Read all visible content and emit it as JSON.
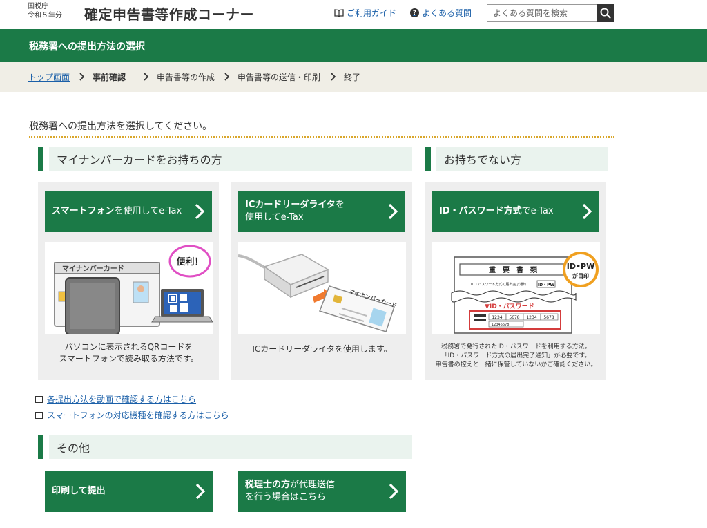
{
  "header": {
    "agency_line1": "国税庁",
    "agency_line2": "令和５年分",
    "app_title": "確定申告書等作成コーナー",
    "guide_link": "ご利用ガイド",
    "faq_link": "よくある質問",
    "search_placeholder": "よくある質問を検索"
  },
  "page": {
    "title": "税務署への提出方法の選択",
    "instruction": "税務署への提出方法を選択してください。"
  },
  "breadcrumb": {
    "items": [
      "トップ画面",
      "事前確認",
      "申告書等の作成",
      "申告書等の送信・印刷",
      "終了"
    ]
  },
  "sections": {
    "mynumber": "マイナンバーカードをお持ちの方",
    "nocard": "お持ちでない方",
    "other": "その他"
  },
  "cards": {
    "smartphone": {
      "label_bold": "スマートフォン",
      "label_rest": "を使用してe-Tax",
      "caption_line1": "パソコンに表示されるQRコードを",
      "caption_line2": "スマートフォンで読み取る方法です。",
      "illus_card_label": "マイナンバーカード",
      "illus_bubble": "便利！"
    },
    "icreader": {
      "label_bold": "ICカードリーダライタ",
      "label_rest1": "を",
      "label_rest2": "使用してe-Tax",
      "caption": "ICカードリーダライタを使用します。",
      "illus_card_label": "マイナンバーカード"
    },
    "idpw": {
      "label_bold": "ID・パスワード方式",
      "label_rest": "でe-Tax",
      "caption_line1": "税務署で発行されたID・パスワードを利用する方法。",
      "caption_line2": "「ID・パスワード方式の届出完了通知」が必要です。",
      "caption_line3": "申告書の控えと一緒に保管していないかご確認ください。",
      "illus_doc_title": "重　要　書　類",
      "illus_doc_sub": "ID・パスワード方式の届出完了通知",
      "illus_doc_tag": "ID・PW",
      "illus_badge_line1": "ID•PW",
      "illus_badge_line2": "が目印",
      "illus_idpw_label": "▼ID・パスワード",
      "illus_id_groups": [
        "1234",
        "5678",
        "1234",
        "5678"
      ],
      "illus_id_line2": "12345678"
    }
  },
  "links": {
    "video": "各提出方法を動画で確認する方はこちら",
    "devices": "スマートフォンの対応機種を確認する方はこちら"
  },
  "other_buttons": {
    "print": "印刷して提出",
    "accountant_bold": "税理士の方",
    "accountant_rest1": "が代理送信",
    "accountant_line2": "を行う場合はこちら"
  }
}
